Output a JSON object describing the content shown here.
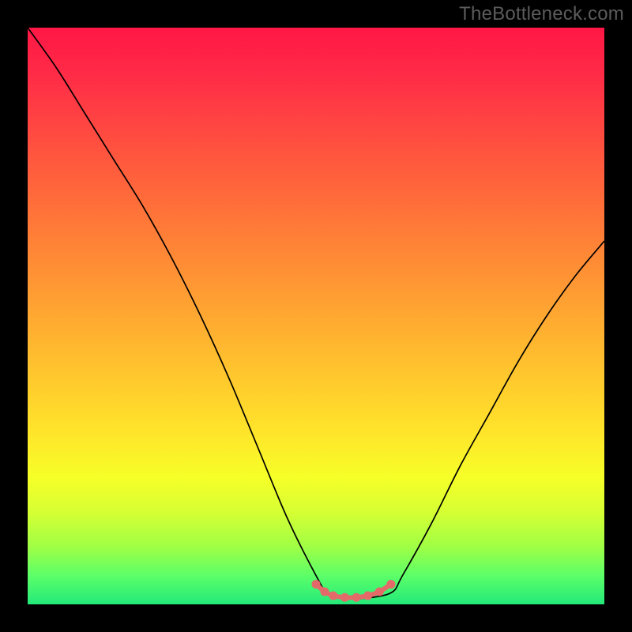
{
  "watermark": {
    "text": "TheBottleneck.com"
  },
  "chart_data": {
    "type": "line",
    "title": "",
    "xlabel": "",
    "ylabel": "",
    "xlim": [
      0,
      100
    ],
    "ylim": [
      0,
      100
    ],
    "x": [
      0,
      5,
      10,
      15,
      20,
      25,
      30,
      35,
      40,
      45,
      50,
      52,
      55,
      58,
      63,
      65,
      70,
      75,
      80,
      85,
      90,
      95,
      100
    ],
    "values": [
      100,
      93,
      85,
      77,
      69,
      60,
      50,
      39,
      27,
      15,
      5,
      2,
      1,
      1,
      2,
      5,
      14,
      24,
      33,
      42,
      50,
      57,
      63
    ],
    "marker_region": {
      "x": [
        50,
        51.5,
        53,
        55,
        57,
        59,
        61,
        63
      ],
      "values": [
        3.5,
        2.2,
        1.5,
        1.2,
        1.2,
        1.5,
        2.2,
        3.5
      ],
      "color": "#e46a6a"
    },
    "gradient_stops": [
      {
        "pos": 0.0,
        "color": "#ff1745"
      },
      {
        "pos": 0.24,
        "color": "#ff5b3d"
      },
      {
        "pos": 0.55,
        "color": "#ffb72f"
      },
      {
        "pos": 0.78,
        "color": "#f6ff28"
      },
      {
        "pos": 0.95,
        "color": "#5cff68"
      },
      {
        "pos": 1.0,
        "color": "#23e97a"
      }
    ]
  }
}
